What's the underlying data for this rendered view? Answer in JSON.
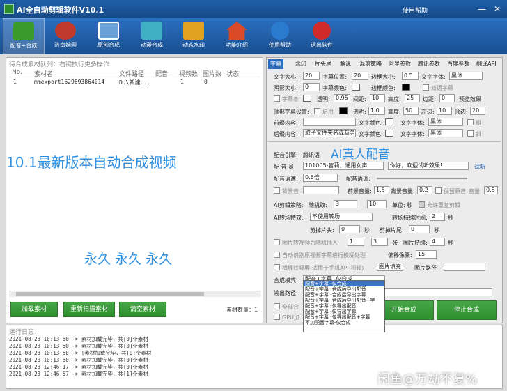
{
  "window": {
    "title": "AI全自动剪辑软件V10.1",
    "help_menu": "使用帮助",
    "min": "—",
    "close": "✕"
  },
  "toolbar": [
    {
      "label": "配音+合成",
      "icon": "clapperboard-icon",
      "color": "#3a9a2c"
    },
    {
      "label": "济南婉网",
      "icon": "film-reel-icon",
      "color": "#c0392b"
    },
    {
      "label": "原创合成",
      "icon": "picture-icon",
      "color": "#6aa2d8"
    },
    {
      "label": "动漫合成",
      "icon": "video-icon",
      "color": "#3fb0c4"
    },
    {
      "label": "动态水印",
      "icon": "ticket-icon",
      "color": "#e0a020"
    },
    {
      "label": "功能介绍",
      "icon": "house-icon",
      "color": "#d84a2a"
    },
    {
      "label": "使用帮助",
      "icon": "help-icon",
      "color": "#2a7ad0"
    },
    {
      "label": "退出软件",
      "icon": "exit-icon",
      "color": "#d02a2a"
    }
  ],
  "queue": {
    "title": "待合成素材队列：右键执行更多操作",
    "columns": [
      "No.",
      "素材名",
      "文件路径",
      "配音",
      "视频数",
      "图片数",
      "状态"
    ],
    "rows": [
      {
        "no": "1",
        "name": "mmexport1629693864014",
        "path": "D:\\新建...",
        "dub": "",
        "videos": "1",
        "images": "0",
        "status": ""
      }
    ]
  },
  "promo": {
    "line1": "10.1最新版本自动合成视频",
    "line2": "永久 永久 永久",
    "line3": "AI真人配音"
  },
  "buttons": {
    "add": "加载素材",
    "rescan": "重新扫描素材",
    "clear": "清空素材",
    "count": "素材数量：1",
    "start": "开始合成",
    "stop": "停止合成"
  },
  "tabs": [
    "字幕",
    "水印",
    "片头尾",
    "解说",
    "混剪策略",
    "阿里参数",
    "腾讯参数",
    "百度参数",
    "翻译API"
  ],
  "subtitle": {
    "font_size_label": "文字大小:",
    "font_size": "20",
    "pos_label": "字幕位置:",
    "pos": "20",
    "border_label": "边框大小:",
    "border": "0.5",
    "font_label": "文字字体:",
    "font": "黑体",
    "shadow_label": "阴影大小:",
    "shadow": "0",
    "color_label": "字幕颜色:",
    "border_color_label": "边框颜色:",
    "bilingual": "双语字幕",
    "bar_label": "字幕条",
    "alpha_label": "透明:",
    "alpha": "0.95",
    "spacing_label": "间距:",
    "spacing": "10",
    "height_label": "高度:",
    "height": "25",
    "margin_label": "边距:",
    "margin": "0",
    "preview": "预览效果",
    "top_label": "顶部字幕设置:",
    "enable": "启用",
    "top_alpha": "1.0",
    "top_height": "50",
    "top_left_label": "左边:",
    "top_left": "10",
    "top_pos_label": "顶边:",
    "top_pos": "20",
    "front_label": "前缀内容:",
    "text_color_label": "文字颜色:",
    "text_font_label": "文字字体:",
    "text_font": "黑体",
    "bold": "粗",
    "back_label": "后缀内容:",
    "back_value": "取子文件夹名或商务",
    "italic": "斜"
  },
  "dubbing": {
    "engine_label": "配音引擎:",
    "engine": "腾讯语",
    "voice_label": "配 音 员:",
    "voice": "101005-智莉，通用女声",
    "preview_text": "你好，欢迎试听效果!",
    "listen": "试听",
    "speed_label": "配音语速:",
    "speed": "0.6倍",
    "tone_label": "配音语调:",
    "bgm_label": "背景音",
    "bgm_vol_label": "前景音量:",
    "bgm_vol": "1.5",
    "back_vol_label": "背景音量:",
    "back_vol": "0.2",
    "keep_audio": "保留原音",
    "vol_label": "音量",
    "vol": "0.8",
    "cut_label": "AI剪辑策略:",
    "random_label": "随机取:",
    "r1": "3",
    "r2": "10",
    "unit": "单位: 秒",
    "repeat": "允许重复剪辑",
    "trans_label": "AI转场特效:",
    "trans": "不使用转场",
    "trans_time_label": "转场持续时间:",
    "trans_time": "2",
    "sec": "秒",
    "cut_head_label": "剪掉片头:",
    "cut_head": "0",
    "cut_tail_label": "剪掉片尾:",
    "cut_tail": "0",
    "pic_insert": "图片转视频后随机插入",
    "pic_a": "1",
    "pic_b": "3",
    "pic_unit": "张",
    "pic_dur_label": "图片持续:",
    "pic_dur": "4",
    "auto_sub": "自动识别原视频字幕进行模糊处理",
    "offset_label": "偏移像素:",
    "offset": "15",
    "landscape": "横屏转竖屏(适用于手机APP视频)",
    "fill": "图片填充",
    "pic_path_label": "图片路径",
    "mode_label": "合成模式:",
    "mode": "配音+字幕 -仅合成",
    "out_label": "输出路径:",
    "all_label": "全部合",
    "gpu_label": "GPU加"
  },
  "mode_options": [
    "配音+字幕 -仅合成",
    "配音+字幕 -合成后导出配音",
    "配音+字幕 -合成后导出字幕",
    "配音+字幕 -合成后导出配音+字",
    "配音+字幕 -仅导出配音",
    "配音+字幕 -仅导出字幕",
    "配音+字幕 -仅导出配音+字幕",
    "不加配音字幕-仅合成"
  ],
  "log": {
    "title": "运行日志：",
    "lines": [
      "2021-08-23 10:13:50 -> 素材加载完毕，共[0]个素材",
      "2021-08-23 10:13:50 -> 素材加载完毕，共[0]个素材",
      "2021-08-23 10:13:50 -> [素材加载完毕，共[0]个素材",
      "2021-08-23 10:13:50 -> 素材加载完毕，共[0]个素材",
      "2021-08-23 12:46:17 -> 素材加载完毕，共[0]个素材",
      "2021-08-23 12:46:57 -> 素材加载完毕，共[1]个素材"
    ]
  },
  "watermark": "闲鱼@万劫不复%"
}
